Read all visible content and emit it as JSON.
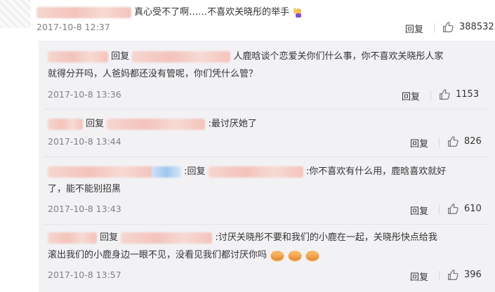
{
  "top": {
    "text": "真心受不了啊……不喜欢关晓彤的举手",
    "date": "2017-10-8 12:37",
    "reply": "回复",
    "likes": "388532"
  },
  "replies": [
    {
      "prefix": "回复",
      "text": "人鹿晗谈个恋爱关你们什么事，你不喜欢关晓彤人家",
      "text2": "就得分开吗，人爸妈都还没有管呢，你们凭什么管？",
      "date": "2017-10-8 13:36",
      "reply": "回复",
      "likes": "1153"
    },
    {
      "prefix": "回复",
      "text": ":最讨厌她了",
      "date": "2017-10-8 13:44",
      "reply": "回复",
      "likes": "826"
    },
    {
      "prefix": ":回复",
      "text": ":你不喜欢有什么用，鹿晗喜欢就好",
      "text2": "了，能不能别招黑",
      "date": "2017-10-8 13:43",
      "reply": "回复",
      "likes": "610"
    },
    {
      "prefix": "回复",
      "text": ":讨厌关晓彤不要和我们的小鹿在一起，关晓彤快点给我",
      "text2": "滚出我们的小鹿身边一眼不见，没看见我们都讨厌你吗",
      "date": "2017-10-8 13:57",
      "reply": "回复",
      "likes": "396"
    }
  ],
  "icons": [
    "raising-hand-emoji",
    "thumbs-up-icon",
    "fist-emoji"
  ]
}
